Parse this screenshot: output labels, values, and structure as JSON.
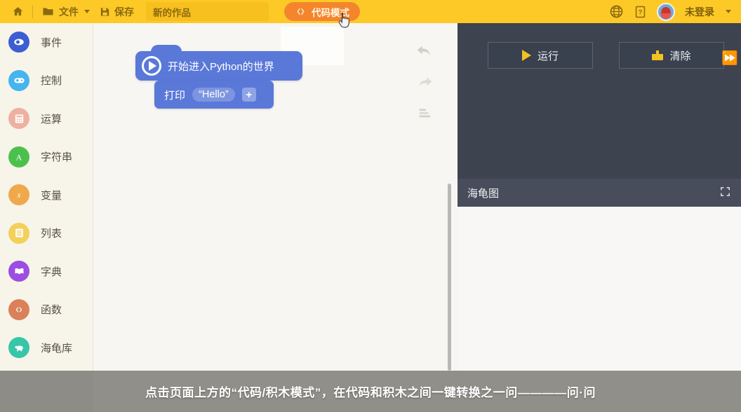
{
  "toolbar": {
    "home_icon": "home-icon",
    "file_label": "文件",
    "file_icon": "folder-icon",
    "save_label": "保存",
    "save_icon": "floppy-disk-icon",
    "project_name": "新的作品",
    "project_placeholder": "新的作品",
    "mode_label": "代码模式",
    "mode_icon": "code-brackets-icon",
    "language_icon": "globe-icon",
    "help_icon": "question-mark-icon",
    "avatar_icon": "user-avatar",
    "login_label": "未登录",
    "accent_bg": "#fdc927",
    "mode_bg": "#f5852c"
  },
  "sidebar": {
    "items": [
      {
        "label": "事件",
        "icon": "event-icon",
        "color": "#3d5dd4"
      },
      {
        "label": "控制",
        "icon": "gamepad-icon",
        "color": "#45b4ef"
      },
      {
        "label": "运算",
        "icon": "calculator-icon",
        "color": "#eeb0a0"
      },
      {
        "label": "字符串",
        "icon": "string-icon",
        "color": "#4cc04c"
      },
      {
        "label": "变量",
        "icon": "variable-x-icon",
        "color": "#efa94a"
      },
      {
        "label": "列表",
        "icon": "list-icon",
        "color": "#f2d05a"
      },
      {
        "label": "字典",
        "icon": "dictionary-icon",
        "color": "#9b4ee0"
      },
      {
        "label": "函数",
        "icon": "function-icon",
        "color": "#d98158"
      },
      {
        "label": "海龟库",
        "icon": "turtle-icon",
        "color": "#36c6a8"
      }
    ]
  },
  "canvas": {
    "blocks": {
      "hat_label": "开始进入Python的世界",
      "hat_icon": "play-circle-icon",
      "print_label": "打印",
      "print_value": "“Hello”",
      "add_label": "+",
      "block_color": "#5a78d8"
    },
    "tools": [
      {
        "name": "undo-icon"
      },
      {
        "name": "redo-icon"
      },
      {
        "name": "align-blocks-icon"
      }
    ]
  },
  "right_panel": {
    "run_label": "运行",
    "run_icon": "play-triangle-icon",
    "clear_label": "清除",
    "clear_icon": "broom-icon",
    "fastforward_icon": "fast-forward-icon",
    "turtle_title": "海龟图",
    "expand_icon": "fullscreen-expand-icon",
    "panel_bg": "#3e4350",
    "bar_bg": "#474d5b"
  },
  "subtitle": {
    "text": "点击页面上方的“代码/积木模式”，在代码和积木之间一键转换",
    "tail": "之一问————问·问"
  }
}
